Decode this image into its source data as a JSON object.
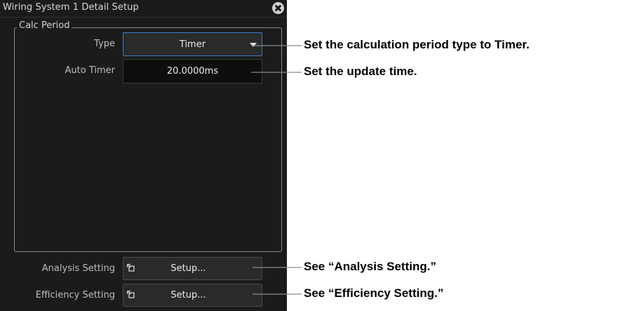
{
  "dialog": {
    "title": "Wiring System 1 Detail Setup",
    "close_icon": "close-circle-icon"
  },
  "calc_period": {
    "group_label": "Calc Period",
    "type_label": "Type",
    "type_value": "Timer",
    "auto_timer_label": "Auto Timer",
    "auto_timer_value": "20.0000ms"
  },
  "analysis": {
    "label": "Analysis Setting",
    "button_label": "Setup...",
    "icon": "open-dialog-icon"
  },
  "efficiency": {
    "label": "Efficiency Setting",
    "button_label": "Setup...",
    "icon": "open-dialog-icon"
  },
  "annotations": {
    "type": "Set the calculation period type to Timer.",
    "timer": "Set the update time.",
    "analysis": "See “Analysis Setting.”",
    "efficiency": "See “Efficiency Setting.”"
  },
  "colors": {
    "panel_bg": "#1b1b1b",
    "focus_border": "#3d7fc6",
    "text": "#ececec"
  }
}
